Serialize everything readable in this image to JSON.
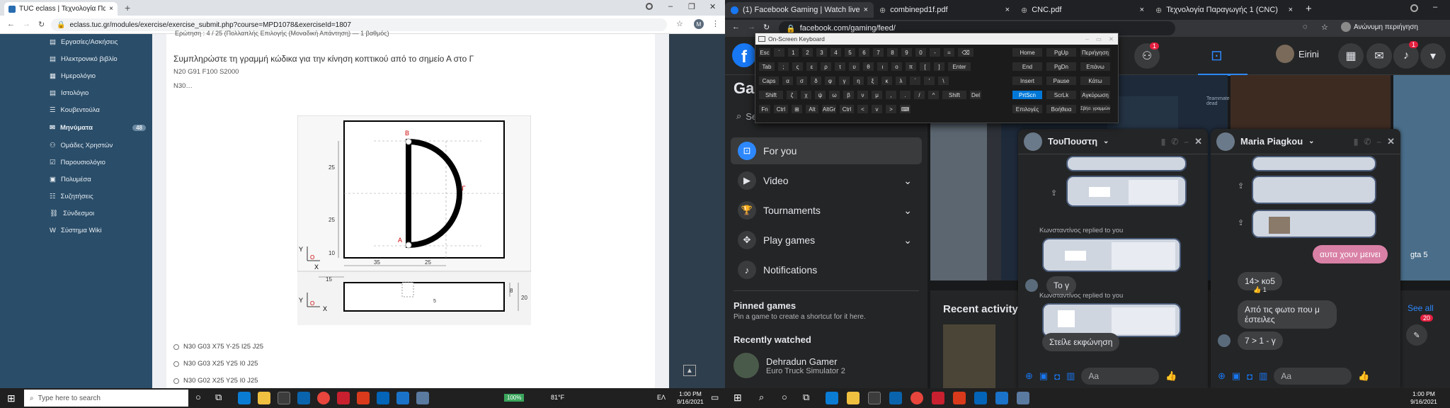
{
  "left": {
    "tabs": [
      {
        "title": "TUC eclass | Τεχνολογία Παραγω…"
      }
    ],
    "url": "eclass.tuc.gr/modules/exercise/exercise_submit.php?course=MPD1078&exerciseId=1807",
    "profile_initial": "M",
    "sidebar": [
      {
        "label": "Εργασίες/Ασκήσεις"
      },
      {
        "label": "Ηλεκτρονικό βιβλίο"
      },
      {
        "label": "Ημερολόγιο"
      },
      {
        "label": "Ιστολόγιο"
      },
      {
        "label": "Κουβεντούλα"
      },
      {
        "label": "Μηνύματα",
        "badge": "48"
      },
      {
        "label": "Ομάδες Χρηστών"
      },
      {
        "label": "Παρουσιολόγιο"
      },
      {
        "label": "Πολυμέσα"
      },
      {
        "label": "Συζητήσεις"
      },
      {
        "label": "Σύνδεσμοι"
      },
      {
        "label": "Σύστημα Wiki"
      }
    ],
    "question": {
      "header": "Ερώτηση : 4 / 25 (Πολλαπλής Επιλογής (Μοναδική Απάντηση) — 1 βαθμός)",
      "title": "Συμπληρώστε τη γραμμή κώδικα για την κίνηση κοπτικού από το σημείο Α στο Γ",
      "line1": "N20 G91 F100 S2000",
      "line2": "N30…",
      "options": [
        "N30 G03 X75 Y-25 I25 J25",
        "N30 G03 X25 Y25 I0 J25",
        "N30 G02 X25 Y25 I0 J25"
      ]
    },
    "drawing": {
      "labels": {
        "b": "B",
        "a": "A",
        "g": "Γ"
      },
      "dims": {
        "d25a": "25",
        "d25b": "25",
        "d10": "10",
        "d35": "35",
        "d25c": "25",
        "d15": "15",
        "d8": "8",
        "d20": "20",
        "d5": "5"
      },
      "axes": {
        "y": "Y",
        "x": "X",
        "z": "Z",
        "o": "O"
      }
    },
    "taskbar": {
      "search_placeholder": "Type here to search",
      "battery": "100%",
      "temp": "81°F",
      "lang": "ΕΛ",
      "time": "1:00 PM",
      "date": "9/16/2021"
    }
  },
  "right": {
    "tabs": [
      {
        "title": "(1) Facebook Gaming | Watch live…"
      },
      {
        "title": "combinepd1f.pdf"
      },
      {
        "title": "CNC.pdf"
      },
      {
        "title": "Τεχνολογία Παραγωγής 1 (CNC)"
      }
    ],
    "incognito": "Ανώνυμη περιήγηση",
    "url": "facebook.com/gaming/feed/",
    "user_name": "Eirini",
    "badge_groups": "1",
    "badge_notif": "1",
    "page_title": "Gaming",
    "search_placeholder": "Search",
    "nav": [
      {
        "label": "For you"
      },
      {
        "label": "Video"
      },
      {
        "label": "Tournaments"
      },
      {
        "label": "Play games"
      },
      {
        "label": "Notifications"
      }
    ],
    "pinned_title": "Pinned games",
    "pinned_sub": "Pin a game to create a shortcut for it here.",
    "recent_title": "Recently watched",
    "recent_item": {
      "name": "Dehradun Gamer",
      "game": "Euro Truck Simulator 2"
    },
    "recent_activity": "Recent activity",
    "see_all": "See all",
    "float_badge": "20",
    "stream_overlay": "Teammate dead",
    "stream_label": "gta 5",
    "chat1": {
      "name": "ΤουΠουστη",
      "reply1": "Κωνσταντίνος replied to you",
      "msg1": "Το γ",
      "reply2": "Κωνσταντίνος replied to you",
      "msg2": "Στείλε εκφώνηση",
      "input": "Aa"
    },
    "chat2": {
      "name": "Maria Piagkou",
      "msg_pink": "αυτα χουν μεινει",
      "msg1": "14> κο5",
      "react": "👍 1",
      "msg2": "Από τις φωτο που μ έστειλες",
      "msg3": "7 > 1 - γ",
      "input": "Aa"
    },
    "osk": {
      "title": "On-Screen Keyboard",
      "rows": [
        [
          "Esc",
          "`",
          "1",
          "2",
          "3",
          "4",
          "5",
          "6",
          "7",
          "8",
          "9",
          "0",
          "-",
          "=",
          "⌫"
        ],
        [
          "Tab",
          ";",
          "ς",
          "ε",
          "ρ",
          "τ",
          "υ",
          "θ",
          "ι",
          "ο",
          "π",
          "[",
          "]",
          "Enter"
        ],
        [
          "Caps",
          "α",
          "σ",
          "δ",
          "φ",
          "γ",
          "η",
          "ξ",
          "κ",
          "λ",
          "΄",
          "'",
          "\\"
        ],
        [
          "Shift",
          "ζ",
          "χ",
          "ψ",
          "ω",
          "β",
          "ν",
          "μ",
          ",",
          ".",
          "/",
          "^",
          "Shift",
          "Del"
        ],
        [
          "Fn",
          "Ctrl",
          "⊞",
          "Alt",
          "AltGr",
          "Ctrl",
          "<",
          "v",
          ">",
          "⌨"
        ]
      ],
      "side": [
        [
          "Home",
          "PgUp",
          "Περιήγηση"
        ],
        [
          "End",
          "PgDn",
          "Επάνω"
        ],
        [
          "Insert",
          "Pause",
          "Κάτω"
        ],
        [
          "PrtScn",
          "ScrLk",
          "Αγκύρωση"
        ],
        [
          "Επιλογές",
          "Βοήθεια",
          "Σβήσ. γραμμών"
        ]
      ]
    },
    "taskbar": {
      "time": "1:00 PM",
      "date": "9/16/2021"
    }
  }
}
